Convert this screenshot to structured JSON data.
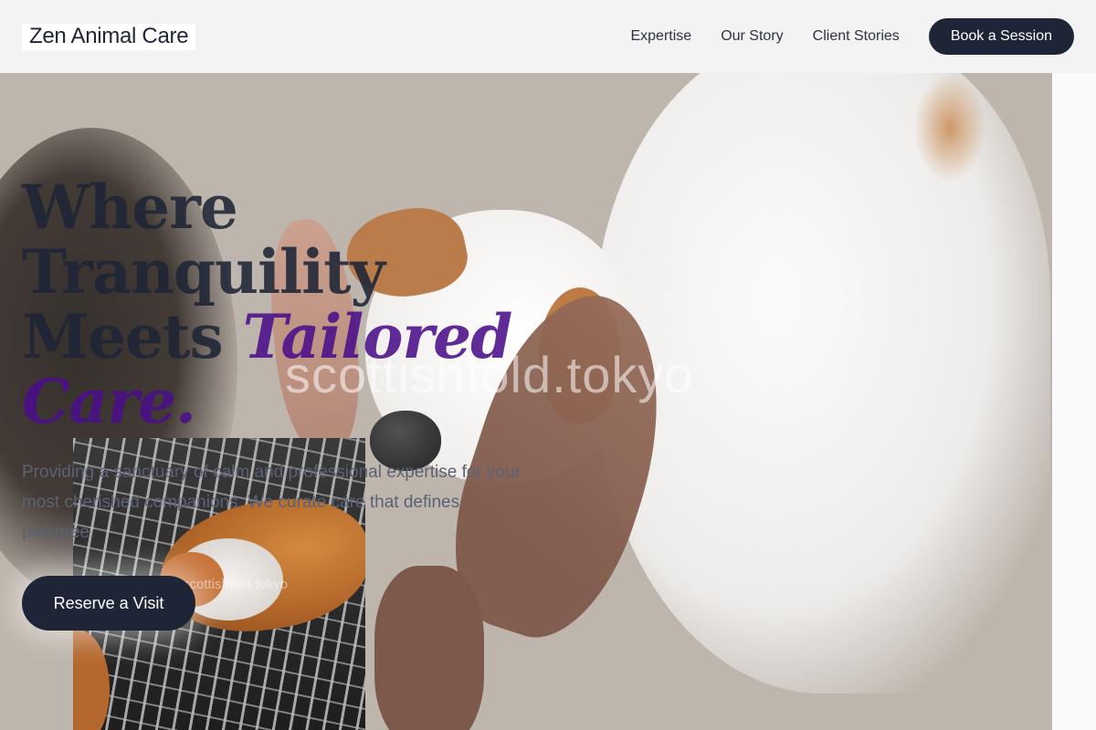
{
  "brand": {
    "name": "Zen Animal Care"
  },
  "nav": {
    "links": [
      "Expertise",
      "Our Story",
      "Client Stories"
    ],
    "cta": "Book a Session"
  },
  "hero": {
    "headline_line1": "Where",
    "headline_line2": "Tranquility",
    "headline_line3": "Meets",
    "headline_accent1": "Tailored",
    "headline_accent2": "Care.",
    "subtext": "Providing a sanctuary of calm and professional expertise for your most cherished companions. We curate care that defines pedigree.",
    "cta": "Reserve a Visit"
  },
  "watermarks": {
    "main": "scottishfold.tokyo",
    "inset": "scottishfold.tokyo"
  },
  "colors": {
    "primary": "#1e2537",
    "accent": "#4b0f8a",
    "nav_bg": "#f4f3f2"
  }
}
